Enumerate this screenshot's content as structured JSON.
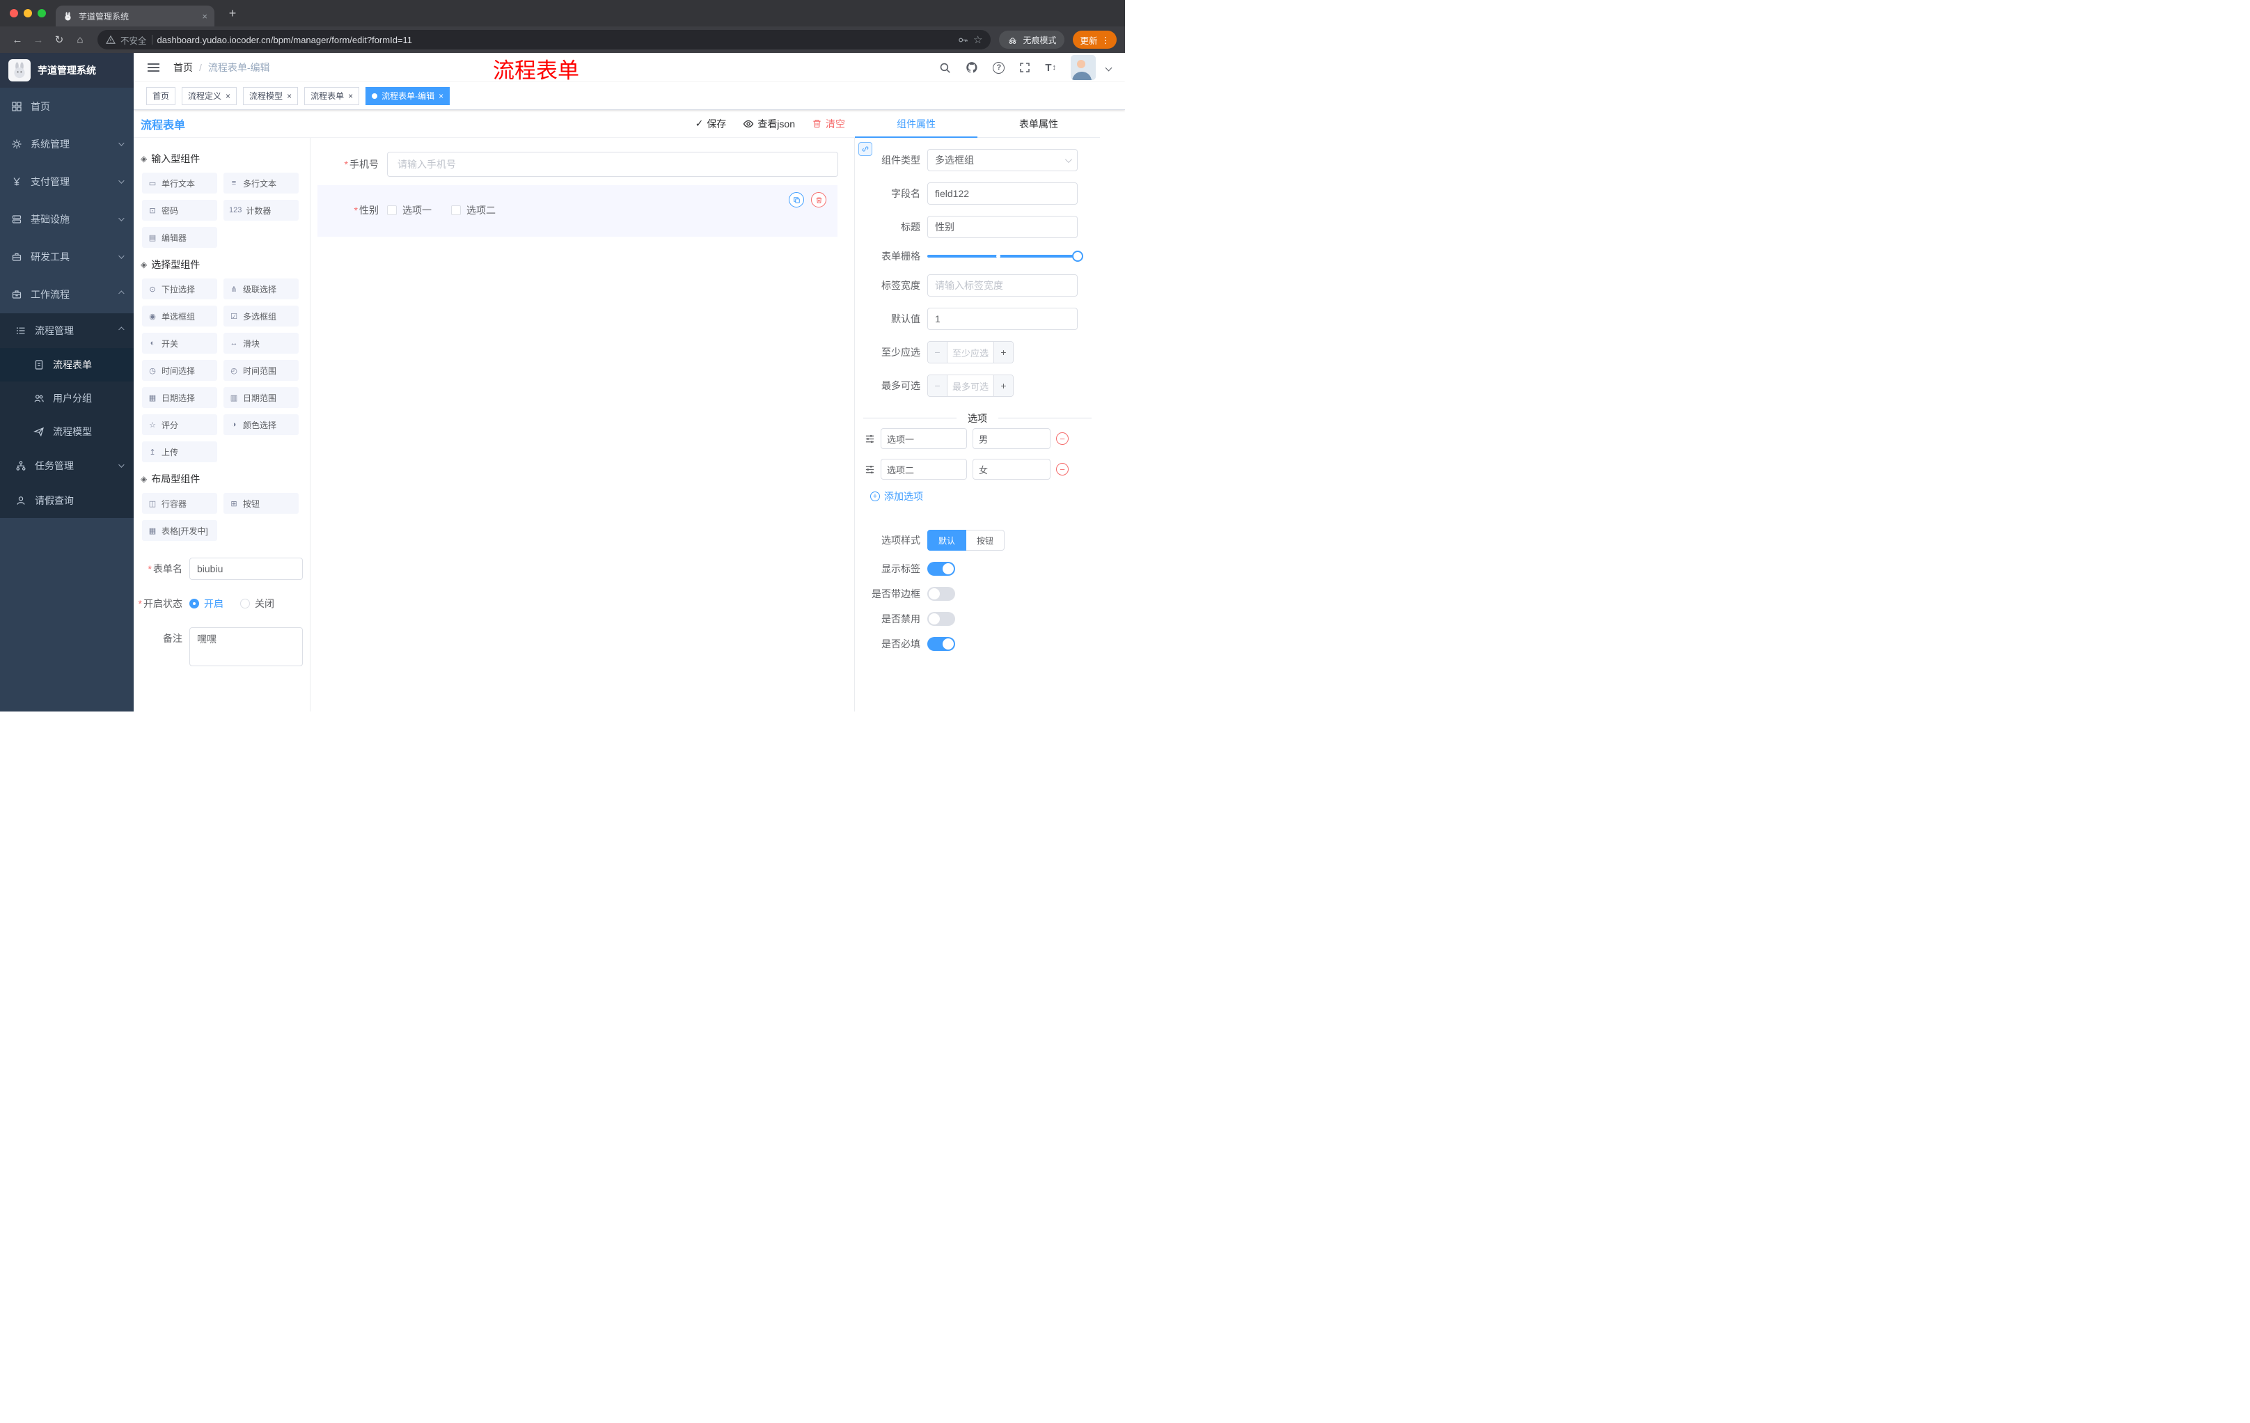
{
  "ui": {
    "required_mark": "*"
  },
  "icons": {
    "back": "←",
    "forward": "→",
    "reload": "↻",
    "home": "⌂",
    "new_tab": "+",
    "close": "×",
    "menu_dots": "⋮",
    "star": "☆",
    "check": "✓",
    "minus": "−",
    "plus": "+",
    "question_mark": "?",
    "text_size": "T",
    "updown": "↕",
    "group": "◈"
  },
  "browser": {
    "tab_title": "芋道管理系统",
    "security_label": "不安全",
    "url": "dashboard.yudao.iocoder.cn/bpm/manager/form/edit?formId=11",
    "incognito_label": "无痕模式",
    "update_label": "更新"
  },
  "sidebar": {
    "logo_title": "芋道管理系统",
    "items": [
      {
        "label": "首页"
      },
      {
        "label": "系统管理"
      },
      {
        "label": "支付管理"
      },
      {
        "label": "基础设施"
      },
      {
        "label": "研发工具"
      },
      {
        "label": "工作流程"
      },
      {
        "label": "流程管理"
      },
      {
        "label": "流程表单"
      },
      {
        "label": "用户分组"
      },
      {
        "label": "流程模型"
      },
      {
        "label": "任务管理"
      },
      {
        "label": "请假查询"
      }
    ]
  },
  "navbar": {
    "breadcrumb_home": "首页",
    "breadcrumb_sep": "/",
    "breadcrumb_current": "流程表单-编辑"
  },
  "annotation": "流程表单",
  "tags": [
    {
      "label": "首页"
    },
    {
      "label": "流程定义"
    },
    {
      "label": "流程模型"
    },
    {
      "label": "流程表单"
    },
    {
      "label": "流程表单-编辑"
    }
  ],
  "designer": {
    "title": "流程表单",
    "save_label": "保存",
    "view_json_label": "查看json",
    "clear_label": "清空",
    "groups": [
      {
        "title": "输入型组件",
        "items": [
          {
            "label": "单行文本",
            "icon": "▭"
          },
          {
            "label": "多行文本",
            "icon": "≡"
          },
          {
            "label": "密码",
            "icon": "⊡"
          },
          {
            "label": "计数器",
            "icon": "123"
          },
          {
            "label": "编辑器",
            "icon": "▤"
          }
        ]
      },
      {
        "title": "选择型组件",
        "items": [
          {
            "label": "下拉选择",
            "icon": "⊙"
          },
          {
            "label": "级联选择",
            "icon": "⋔"
          },
          {
            "label": "单选框组",
            "icon": "◉"
          },
          {
            "label": "多选框组",
            "icon": "☑"
          },
          {
            "label": "开关",
            "icon": "◐"
          },
          {
            "label": "滑块",
            "icon": "↔"
          },
          {
            "label": "时间选择",
            "icon": "◷"
          },
          {
            "label": "时间范围",
            "icon": "◴"
          },
          {
            "label": "日期选择",
            "icon": "▦"
          },
          {
            "label": "日期范围",
            "icon": "▥"
          },
          {
            "label": "评分",
            "icon": "☆"
          },
          {
            "label": "颜色选择",
            "icon": "◑"
          },
          {
            "label": "上传",
            "icon": "↥"
          }
        ]
      },
      {
        "title": "布局型组件",
        "items": [
          {
            "label": "行容器",
            "icon": "◫"
          },
          {
            "label": "按钮",
            "icon": "⊞"
          },
          {
            "label": "表格[开发中]",
            "icon": "▦"
          }
        ]
      }
    ],
    "meta": {
      "form_name_label": "表单名",
      "form_name_value": "biubiu",
      "status_label": "开启状态",
      "status_on": "开启",
      "status_off": "关闭",
      "remark_label": "备注",
      "remark_value": "嘿嘿"
    },
    "canvas": {
      "phone_label": "手机号",
      "phone_placeholder": "请输入手机号",
      "gender_label": "性别",
      "gender_option1": "选项一",
      "gender_option2": "选项二"
    }
  },
  "props": {
    "tab_component": "组件属性",
    "tab_form": "表单属性",
    "component_type_label": "组件类型",
    "component_type_value": "多选框组",
    "field_name_label": "字段名",
    "field_name_value": "field122",
    "title_label": "标题",
    "title_value": "性别",
    "grid_label": "表单栅格",
    "label_width_label": "标签宽度",
    "label_width_placeholder": "请输入标签宽度",
    "default_label": "默认值",
    "default_value": "1",
    "min_label": "至少应选",
    "min_placeholder": "至少应选",
    "max_label": "最多可选",
    "max_placeholder": "最多可选",
    "options_title": "选项",
    "options": [
      {
        "label": "选项一",
        "value": "男"
      },
      {
        "label": "选项二",
        "value": "女"
      }
    ],
    "add_option_label": "添加选项",
    "style_label": "选项样式",
    "style_default": "默认",
    "style_button": "按钮",
    "switch_show_label": "显示标签",
    "switch_border": "是否带边框",
    "switch_disabled": "是否禁用",
    "switch_required": "是否必填"
  },
  "colors": {
    "accent": "#409eff",
    "danger": "#f56c6c",
    "sidebar_bg": "#304156",
    "submenu_bg": "#1f2d3d",
    "update_orange": "#e8710a",
    "annotation_red": "#fe0100"
  }
}
